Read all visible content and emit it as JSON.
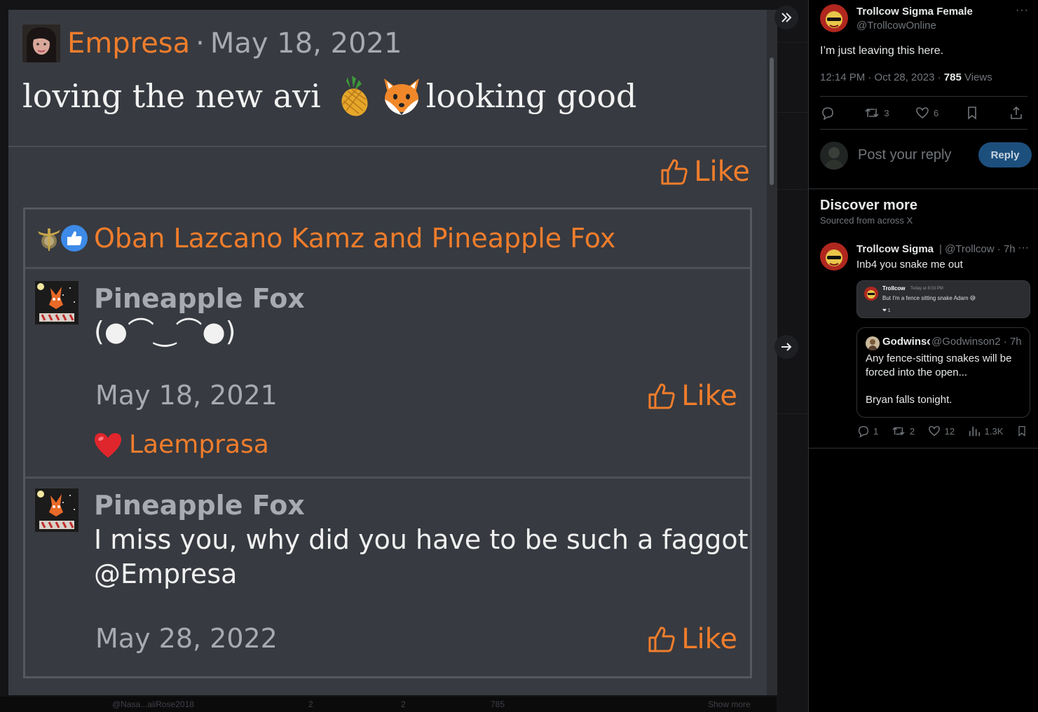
{
  "screenshot_post": {
    "author": "Empresa",
    "separator": "·",
    "date": "May 18, 2021",
    "text_before": "loving the new avi",
    "text_after": "looking good",
    "like_label": "Like"
  },
  "likers": {
    "text": "Oban Lazcano Kamz and Pineapple Fox"
  },
  "replies": [
    {
      "name": "Pineapple Fox",
      "text": "(●⌒‿⌒●)",
      "date": "May 18, 2021",
      "like_label": "Like",
      "reaction_user": "Laemprasa"
    },
    {
      "name": "Pineapple Fox",
      "text": "I miss you, why did you have to be such a faggot",
      "mention": "@Empresa",
      "date": "May 28, 2022",
      "like_label": "Like"
    }
  ],
  "bottom_strip": {
    "handle": "@Nasa...aiiRose2018",
    "retweets": "2",
    "likes": "2",
    "views": "785",
    "more": "Show more"
  },
  "tweet": {
    "name": "Trollcow Sigma Female",
    "handle": "@TrollcowOnline",
    "more": "···",
    "text": "I’m just leaving this here.",
    "time": "12:14 PM · Oct 28, 2023 · ",
    "views_count": "785",
    "views_label": " Views",
    "retweets": "3",
    "likes": "6"
  },
  "reply_box": {
    "placeholder": "Post your reply",
    "button": "Reply"
  },
  "discover": {
    "title": "Discover more",
    "subtitle": "Sourced from across X",
    "post": {
      "name": "Trollcow Sigma",
      "handle": "| @Trollcow · 7h",
      "more": "···",
      "text": "Inb4 you snake me out",
      "discord": {
        "name": "Trollcow",
        "time": "Today at 8:03 PM",
        "text": "But I'm a fence sitting snake Adam 😅",
        "reaction": "❤ 1"
      },
      "quote": {
        "name": "Godwinson",
        "handle": "@Godwinson2 · 7h",
        "text1": "Any fence-sitting snakes will be forced into the open...",
        "text2": "Bryan falls tonight."
      },
      "replies": "1",
      "retweets": "2",
      "likes": "12",
      "views": "1.3K"
    }
  },
  "colors": {
    "accent_orange": "#f07d2c",
    "screenshot_bg": "#373a40",
    "x_blue_button": "#1d4f7d"
  },
  "icons": [
    "double-chevron-right-icon",
    "arrow-right-icon",
    "thumbs-up-icon",
    "heart-icon",
    "reply-icon",
    "retweet-icon",
    "bookmark-icon",
    "share-icon",
    "views-icon"
  ]
}
